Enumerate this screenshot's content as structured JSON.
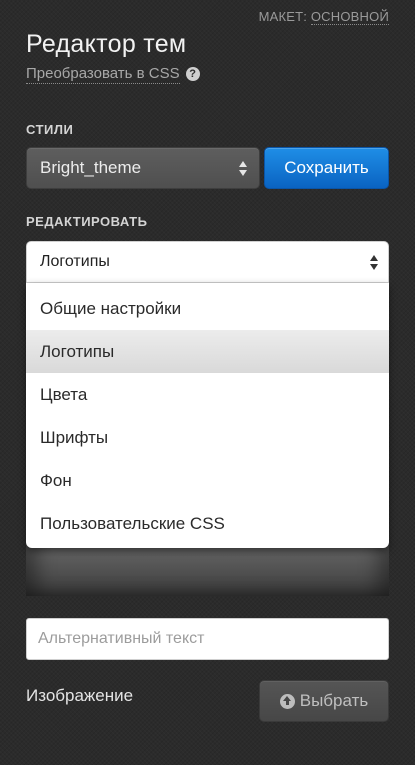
{
  "layout_switch": {
    "label": "МАКЕТ:",
    "value": "ОСНОВНОЙ"
  },
  "header": {
    "title": "Редактор тем",
    "convert_link": "Преобразовать в CSS",
    "help_icon": "question-circle-icon"
  },
  "styles": {
    "label": "СТИЛИ",
    "selected": "Bright_theme",
    "save_label": "Сохранить"
  },
  "edit": {
    "label": "РЕДАКТИРОВАТЬ",
    "selected": "Логотипы",
    "options": [
      "Общие настройки",
      "Логотипы",
      "Цвета",
      "Шрифты",
      "Фон",
      "Пользовательские CSS"
    ],
    "highlighted_index": 1
  },
  "logo": {
    "alt_placeholder": "Альтернативный текст",
    "alt_value": "",
    "image_label": "Изображение",
    "choose_label": "Выбрать",
    "choose_icon": "upload-circle-icon"
  },
  "colors": {
    "background": "#2b2b2b",
    "accent": "#0a63c2"
  }
}
